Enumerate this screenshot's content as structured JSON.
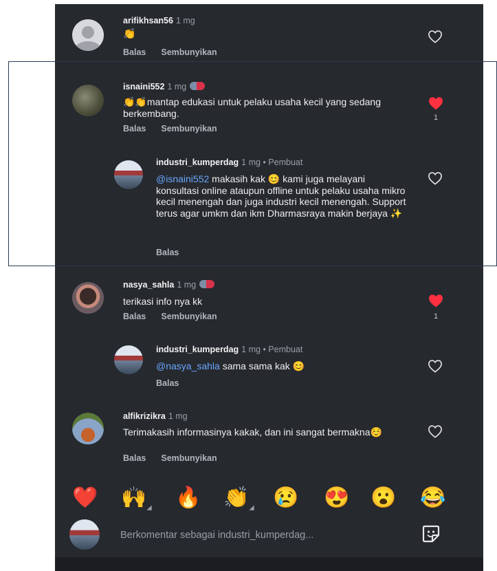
{
  "comments": [
    {
      "username": "arifikhsan56",
      "time": "1 mg",
      "text": "👏",
      "reply": "Balas",
      "hide": "Sembunyikan"
    },
    {
      "username": "isnaini552",
      "time": "1 mg",
      "text": "👏👏mantap edukasi untuk pelaku usaha kecil yang sedang berkembang.",
      "reply": "Balas",
      "hide": "Sembunyikan",
      "likes": "1"
    },
    {
      "username": "industri_kumperdag",
      "time": "1 mg",
      "creator": "• Pembuat",
      "mention": "@isnaini552",
      "text": " makasih kak 😊 kami juga melayani konsultasi online ataupun offline untuk pelaku usaha mikro kecil menengah dan juga industri kecil menengah. Support terus agar umkm dan ikm Dharmasraya makin berjaya ✨",
      "reply": "Balas"
    },
    {
      "username": "nasya_sahla",
      "time": "1 mg",
      "text": "terikasi info nya kk",
      "reply": "Balas",
      "hide": "Sembunyikan",
      "likes": "1"
    },
    {
      "username": "industri_kumperdag",
      "time": "1 mg",
      "creator": "• Pembuat",
      "mention": "@nasya_sahla",
      "text": " sama sama kak 😊",
      "reply": "Balas"
    },
    {
      "username": "alfikrizikra",
      "time": "1 mg",
      "text": "Terimakasih informasinya kakak, dan ini sangat bermakna☺️",
      "reply": "Balas",
      "hide": "Sembunyikan"
    }
  ],
  "reactions": [
    "❤️",
    "🙌",
    "🔥",
    "👏",
    "😢",
    "😍",
    "😮",
    "😂"
  ],
  "composer": {
    "placeholder": "Berkomentar sebagai industri_kumperdag..."
  },
  "colors": {
    "background": "#26292e",
    "like_red": "#ff3040",
    "mention_blue": "#6aa6ff"
  },
  "icons": {
    "like": "heart-icon",
    "sticker": "sticker-icon"
  }
}
